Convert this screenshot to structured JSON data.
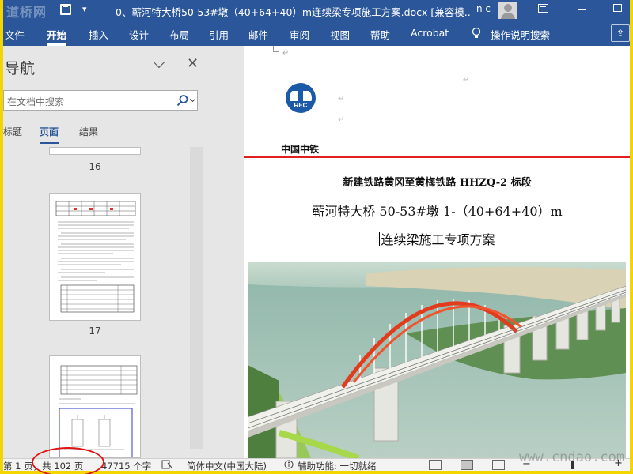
{
  "watermark_top": "道桥网",
  "watermark_bottom": "www.cndao.com",
  "titlebar": {
    "doc_title": "0、蕲河特大桥50-53#墩（40+64+40）m连续梁专项施工方案.docx [兼容模...",
    "user_initials": "n c"
  },
  "ribbon": {
    "tabs": [
      "文件",
      "开始",
      "插入",
      "设计",
      "布局",
      "引用",
      "邮件",
      "审阅",
      "视图",
      "帮助",
      "Acrobat"
    ],
    "active_tab": "开始",
    "tell_me": "操作说明搜索"
  },
  "nav": {
    "title": "导航",
    "search_placeholder": "在文档中搜索",
    "tabs": [
      "标题",
      "页面",
      "结果"
    ],
    "active_tab": "页面",
    "page_numbers": [
      "16",
      "17"
    ]
  },
  "document": {
    "company": "中国中铁",
    "logo_text": "REC",
    "line1": "新建铁路黄冈至黄梅铁路 HHZQ-2 标段",
    "line2": "蕲河特大桥 50-53#墩 1-（40+64+40）m",
    "line3": "连续梁施工专项方案",
    "para_mark": "↵"
  },
  "status": {
    "page": "第 1 页，共 102 页",
    "words": "47715 个字",
    "language": "简体中文(中国大陆)",
    "accessibility": "辅助功能: 一切就绪"
  },
  "colors": {
    "brand": "#2b579a",
    "frame": "#f3d600",
    "annotation": "#e01414",
    "rule": "#e02020"
  }
}
